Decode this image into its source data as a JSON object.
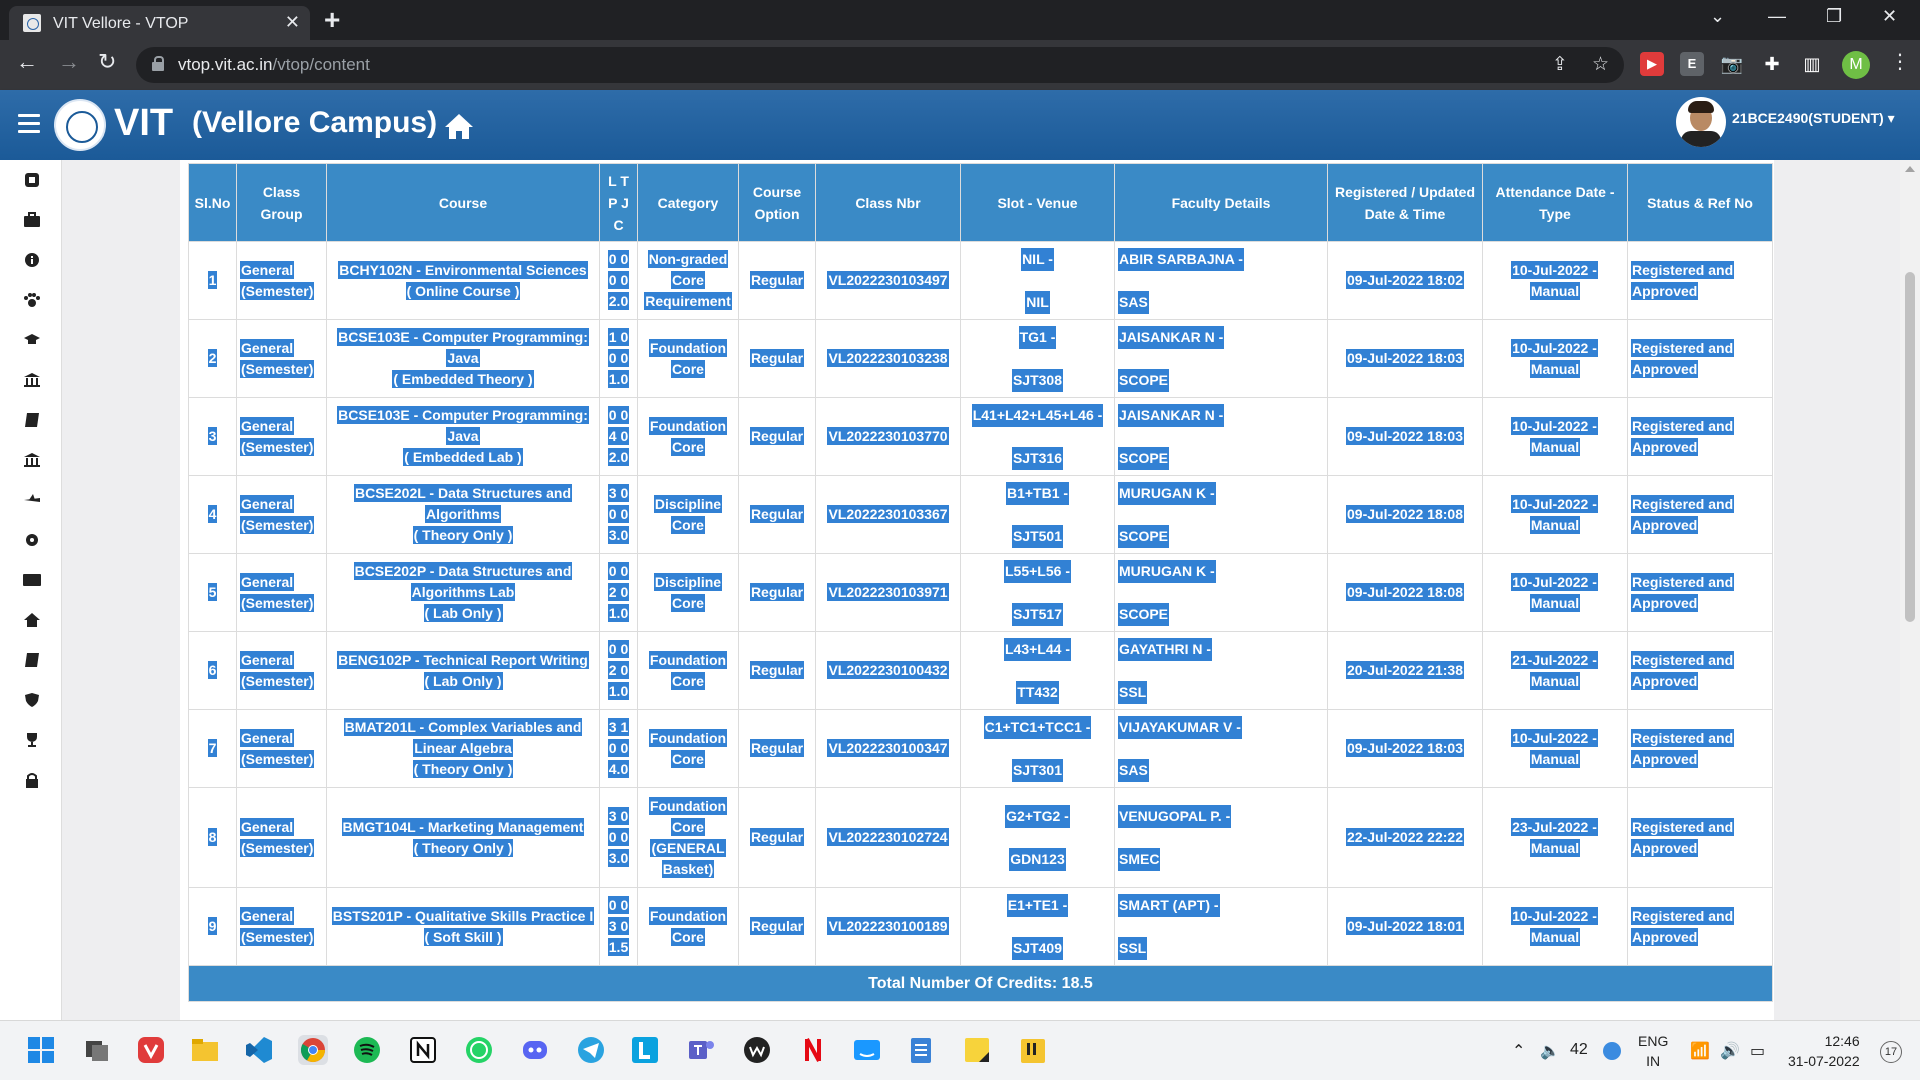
{
  "browser": {
    "tab_title": "VIT Vellore - VTOP",
    "url_host": "vtop.vit.ac.in",
    "url_path": "/vtop/content",
    "profile_initial": "M"
  },
  "header": {
    "brand": "VIT",
    "campus": "(Vellore Campus)",
    "user": "21BCE2490(STUDENT)"
  },
  "table": {
    "columns": [
      "Sl.No",
      "Class Group",
      "Course",
      "L T P J C",
      "Category",
      "Course Option",
      "Class Nbr",
      "Slot - Venue",
      "Faculty Details",
      "Registered / Updated Date & Time",
      "Attendance Date - Type",
      "Status & Ref No"
    ],
    "rows": [
      {
        "sl": "1",
        "group": "General (Semester)",
        "course": "BCHY102N - Environmental Sciences",
        "course_type": "( Online Course )",
        "ltpjc": "0 0 0 0 2.0",
        "category": "Non-graded Core Requirement",
        "option": "Regular",
        "class_nbr": "VL2022230103497",
        "slot": "NIL -",
        "venue": "NIL",
        "faculty": "ABIR SARBAJNA -",
        "school": "SAS",
        "registered": "09-Jul-2022 18:02",
        "attendance": "10-Jul-2022 - Manual",
        "status": "Registered and Approved"
      },
      {
        "sl": "2",
        "group": "General (Semester)",
        "course": "BCSE103E - Computer Programming: Java",
        "course_type": "( Embedded Theory )",
        "ltpjc": "1 0 0 0 1.0",
        "category": "Foundation Core",
        "option": "Regular",
        "class_nbr": "VL2022230103238",
        "slot": "TG1 -",
        "venue": "SJT308",
        "faculty": "JAISANKAR N -",
        "school": "SCOPE",
        "registered": "09-Jul-2022 18:03",
        "attendance": "10-Jul-2022 - Manual",
        "status": "Registered and Approved"
      },
      {
        "sl": "3",
        "group": "General (Semester)",
        "course": "BCSE103E - Computer Programming: Java",
        "course_type": "( Embedded Lab )",
        "ltpjc": "0 0 4 0 2.0",
        "category": "Foundation Core",
        "option": "Regular",
        "class_nbr": "VL2022230103770",
        "slot": "L41+L42+L45+L46 -",
        "venue": "SJT316",
        "faculty": "JAISANKAR N -",
        "school": "SCOPE",
        "registered": "09-Jul-2022 18:03",
        "attendance": "10-Jul-2022 - Manual",
        "status": "Registered and Approved"
      },
      {
        "sl": "4",
        "group": "General (Semester)",
        "course": "BCSE202L - Data Structures and Algorithms",
        "course_type": "( Theory Only )",
        "ltpjc": "3 0 0 0 3.0",
        "category": "Discipline Core",
        "option": "Regular",
        "class_nbr": "VL2022230103367",
        "slot": "B1+TB1 -",
        "venue": "SJT501",
        "faculty": "MURUGAN K -",
        "school": "SCOPE",
        "registered": "09-Jul-2022 18:08",
        "attendance": "10-Jul-2022 - Manual",
        "status": "Registered and Approved"
      },
      {
        "sl": "5",
        "group": "General (Semester)",
        "course": "BCSE202P - Data Structures and Algorithms Lab",
        "course_type": "( Lab Only )",
        "ltpjc": "0 0 2 0 1.0",
        "category": "Discipline Core",
        "option": "Regular",
        "class_nbr": "VL2022230103971",
        "slot": "L55+L56 -",
        "venue": "SJT517",
        "faculty": "MURUGAN K -",
        "school": "SCOPE",
        "registered": "09-Jul-2022 18:08",
        "attendance": "10-Jul-2022 - Manual",
        "status": "Registered and Approved"
      },
      {
        "sl": "6",
        "group": "General (Semester)",
        "course": "BENG102P - Technical Report Writing",
        "course_type": "( Lab Only )",
        "ltpjc": "0 0 2 0 1.0",
        "category": "Foundation Core",
        "option": "Regular",
        "class_nbr": "VL2022230100432",
        "slot": "L43+L44 -",
        "venue": "TT432",
        "faculty": "GAYATHRI N -",
        "school": "SSL",
        "registered": "20-Jul-2022 21:38",
        "attendance": "21-Jul-2022 - Manual",
        "status": "Registered and Approved"
      },
      {
        "sl": "7",
        "group": "General (Semester)",
        "course": "BMAT201L - Complex Variables and Linear Algebra",
        "course_type": "( Theory Only )",
        "ltpjc": "3 1 0 0 4.0",
        "category": "Foundation Core",
        "option": "Regular",
        "class_nbr": "VL2022230100347",
        "slot": "C1+TC1+TCC1 -",
        "venue": "SJT301",
        "faculty": "VIJAYAKUMAR V -",
        "school": "SAS",
        "registered": "09-Jul-2022 18:03",
        "attendance": "10-Jul-2022 - Manual",
        "status": "Registered and Approved"
      },
      {
        "sl": "8",
        "group": "General (Semester)",
        "course": "BMGT104L - Marketing Management",
        "course_type": "( Theory Only )",
        "ltpjc": "3 0 0 0 3.0",
        "category": "Foundation Core (GENERAL Basket)",
        "option": "Regular",
        "class_nbr": "VL2022230102724",
        "slot": "G2+TG2 -",
        "venue": "GDN123",
        "faculty": "VENUGOPAL P. -",
        "school": "SMEC",
        "registered": "22-Jul-2022 22:22",
        "attendance": "23-Jul-2022 - Manual",
        "status": "Registered and Approved"
      },
      {
        "sl": "9",
        "group": "General (Semester)",
        "course": "BSTS201P - Qualitative Skills Practice I",
        "course_type": "( Soft Skill )",
        "ltpjc": "0 0 3 0 1.5",
        "category": "Foundation Core",
        "option": "Regular",
        "class_nbr": "VL2022230100189",
        "slot": "E1+TE1 -",
        "venue": "SJT409",
        "faculty": "SMART (APT) -",
        "school": "SSL",
        "registered": "09-Jul-2022 18:01",
        "attendance": "10-Jul-2022 - Manual",
        "status": "Registered and Approved"
      }
    ],
    "total_credits": "Total Number Of Credits: 18.5"
  },
  "taskbar": {
    "temperature": "42",
    "lang_top": "ENG",
    "lang_bottom": "IN",
    "time": "12:46",
    "date": "31-07-2022",
    "notifications": "17"
  },
  "colors": {
    "header_blue": "#1b5a98",
    "table_header": "#3a8ac6",
    "selection": "#3281d4"
  }
}
